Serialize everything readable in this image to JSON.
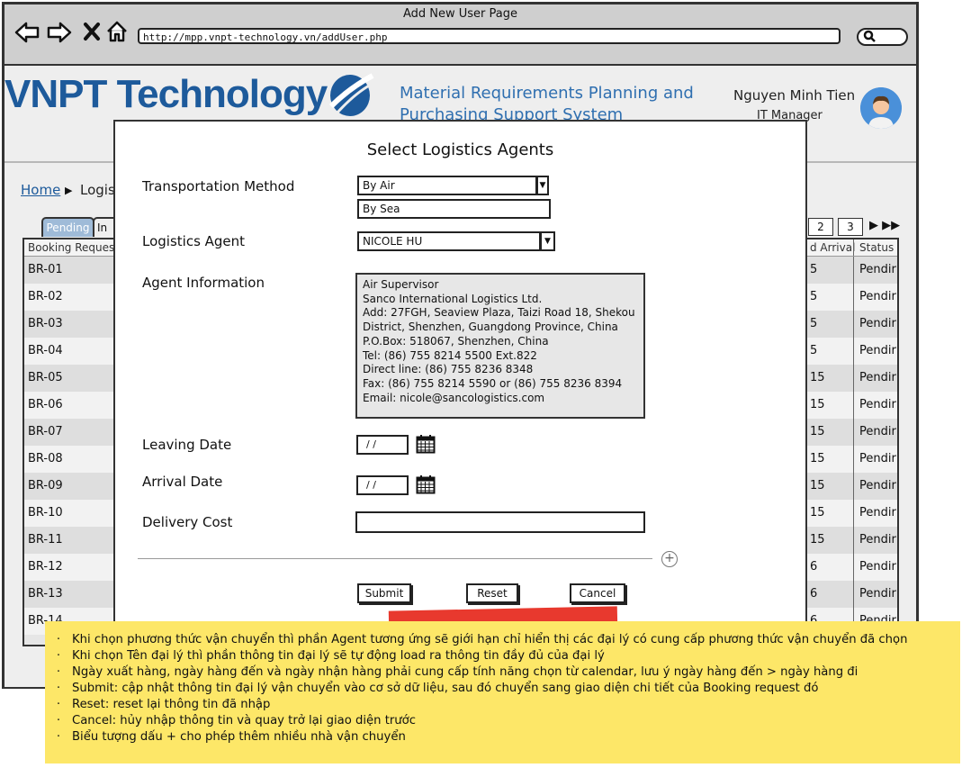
{
  "browser": {
    "window_title": "Add New User Page",
    "url": "http://mpp.vnpt-technology.vn/addUser.php"
  },
  "header": {
    "logo_text": "VNPT Technology",
    "system_title": "Material Requirements Planning and Purchasing Support System",
    "user_name": "Nguyen Minh Tien",
    "user_role": "IT Manager"
  },
  "breadcrumb": {
    "home": "Home",
    "current": "Logis"
  },
  "tabs": [
    "Pending",
    "In"
  ],
  "pagination": [
    "2",
    "3"
  ],
  "table": {
    "left_header": "Booking Reques",
    "right_headers": [
      "d Arrival",
      "Status"
    ],
    "rows": [
      {
        "id": "BR-01",
        "arrival": "5",
        "status": "Pendir"
      },
      {
        "id": "BR-02",
        "arrival": "5",
        "status": "Pendir"
      },
      {
        "id": "BR-03",
        "arrival": "5",
        "status": "Pendir"
      },
      {
        "id": "BR-04",
        "arrival": "5",
        "status": "Pendir"
      },
      {
        "id": "BR-05",
        "arrival": "15",
        "status": "Pendir"
      },
      {
        "id": "BR-06",
        "arrival": "15",
        "status": "Pendir"
      },
      {
        "id": "BR-07",
        "arrival": "15",
        "status": "Pendir"
      },
      {
        "id": "BR-08",
        "arrival": "15",
        "status": "Pendir"
      },
      {
        "id": "BR-09",
        "arrival": "15",
        "status": "Pendir"
      },
      {
        "id": "BR-10",
        "arrival": "15",
        "status": "Pendir"
      },
      {
        "id": "BR-11",
        "arrival": "15",
        "status": "Pendir"
      },
      {
        "id": "BR-12",
        "arrival": "6",
        "status": "Pendir"
      },
      {
        "id": "BR-13",
        "arrival": "6",
        "status": "Pendir"
      },
      {
        "id": "BR-14",
        "arrival": "6",
        "status": "Pendir"
      }
    ]
  },
  "modal": {
    "title": "Select Logistics Agents",
    "transport_label": "Transportation Method",
    "transport_selected": "By Air",
    "transport_option": "By Sea",
    "agent_label": "Logistics Agent",
    "agent_selected": "NICOLE HU",
    "info_label": "Agent Information",
    "agent_info": [
      "Air Supervisor",
      "Sanco International Logistics Ltd.",
      "Add: 27FGH, Seaview Plaza, Taizi Road 18, Shekou",
      "District, Shenzhen, Guangdong Province, China",
      "P.O.Box: 518067, Shenzhen, China",
      "Tel: (86) 755 8214 5500  Ext.822",
      "Direct line: (86) 755 8236 8348",
      "Fax: (86) 755 8214 5590 or (86) 755 8236 8394",
      "Email: nicole@sancologistics.com"
    ],
    "leaving_label": "Leaving Date",
    "leaving_value": "/ /",
    "arrival_label": "Arrival Date",
    "arrival_value": "/ /",
    "cost_label": "Delivery Cost",
    "cost_value": "",
    "submit": "Submit",
    "reset": "Reset",
    "cancel": "Cancel"
  },
  "note": {
    "items": [
      "Khi chọn phương thức vận chuyển thì phần Agent tương ứng sẽ giới hạn chỉ hiển thị các đại lý có cung cấp phương thức vận chuyển đã chọn",
      "Khi chọn Tên đại lý thì phần thông tin đại lý sẽ tự động load ra thông tin đầy đủ của đại lý",
      "Ngày xuất hàng, ngày hàng đến và ngày nhận hàng phải cung cấp tính năng chọn từ calendar, lưu ý ngày hàng đến > ngày hàng đi",
      "Submit: cập nhật thông tin đại lý vận chuyển vào cơ sở dữ liệu, sau đó chuyển sang giao diện chi tiết của Booking request đó",
      "Reset: reset lại thông tin đã nhập",
      "Cancel: hủy nhập thông tin và quay trở lại giao diện trước",
      "Biểu tượng dấu + cho phép thêm nhiều nhà vận chuyển"
    ]
  },
  "colors": {
    "brand_blue": "#1d5a9b",
    "title_blue": "#2f6fb0",
    "note_yellow": "#fde768",
    "marker_red": "#e8392e"
  },
  "icons": [
    "back-arrow-icon",
    "forward-arrow-icon",
    "close-icon",
    "home-icon",
    "search-icon",
    "calendar-icon",
    "add-icon",
    "user-avatar-icon"
  ]
}
